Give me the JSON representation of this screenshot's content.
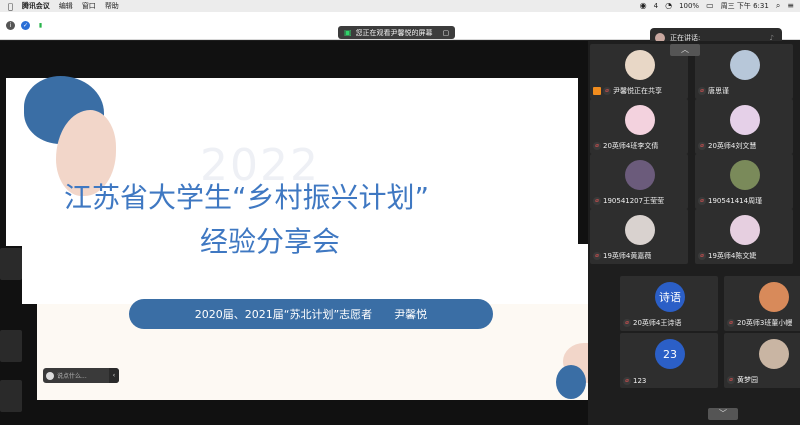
{
  "menubar": {
    "app_name": "腾讯会议",
    "items": [
      "编辑",
      "窗口",
      "帮助"
    ],
    "battery": "100%",
    "wechat_count": "4",
    "datetime": "周三 下午 6:31",
    "apple_icon": "apple-icon"
  },
  "toolbar": {
    "watching_text": "您正在观看尹馨悦的屏幕",
    "speaking_label": "正在讲话:"
  },
  "slide": {
    "watermark": "2022",
    "title_line1": "江苏省大学生“乡村振兴计划”",
    "title_line2": "经验分享会",
    "banner_left": "2020届、2021届“苏北计划”志愿者",
    "banner_right": "尹馨悦",
    "chat_placeholder": "说点什么..."
  },
  "participants": [
    {
      "name": "尹馨悦正在共享",
      "sharing": true
    },
    {
      "name": "唐思谨"
    },
    {
      "name": "20英师4班李文倩"
    },
    {
      "name": "20英师4刘文慧"
    },
    {
      "name": "190541207王莹莹"
    },
    {
      "name": "190541414周瑾"
    },
    {
      "name": "19英师4黄嘉薇"
    },
    {
      "name": "19英师4陈文婕"
    },
    {
      "name": "20英师4王诗语",
      "avatar_text": "诗语"
    },
    {
      "name": "20英师3班董小幔"
    },
    {
      "name": "123",
      "avatar_text": "23"
    },
    {
      "name": "黄梦园"
    }
  ],
  "colors": {
    "accent_blue": "#3a6ea5",
    "title_blue": "#3f78c2",
    "peach": "#f2d6c9",
    "panel_bg": "#1e1e1e",
    "tile_bg": "#2e2e2e"
  }
}
